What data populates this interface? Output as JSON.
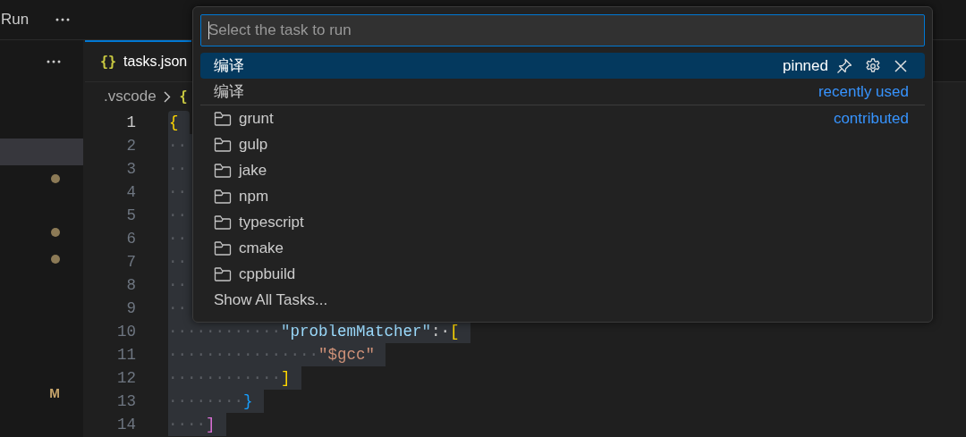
{
  "sidebar": {
    "title": "Run",
    "rows": [
      {
        "kind": "blank"
      },
      {
        "kind": "blank"
      },
      {
        "kind": "highlight"
      },
      {
        "kind": "dot"
      },
      {
        "kind": "blank"
      },
      {
        "kind": "dot"
      },
      {
        "kind": "dot"
      },
      {
        "kind": "blank"
      },
      {
        "kind": "blank"
      },
      {
        "kind": "blank"
      },
      {
        "kind": "blank"
      },
      {
        "kind": "status",
        "status": "M"
      }
    ]
  },
  "editor": {
    "tab": {
      "icon": "{}",
      "label": "tasks.json",
      "selected": true
    },
    "breadcrumb": [
      {
        "label": ".vscode"
      },
      {
        "icon": "{"
      }
    ],
    "lines": [
      {
        "number": "1",
        "active": true,
        "tokens": [
          {
            "text": "{",
            "color": "#ffd700"
          }
        ]
      },
      {
        "number": "2",
        "active": false,
        "whitespace": "··"
      },
      {
        "number": "3",
        "active": false,
        "whitespace": "··"
      },
      {
        "number": "4",
        "active": false,
        "whitespace": "··"
      },
      {
        "number": "5",
        "active": false,
        "whitespace": "··"
      },
      {
        "number": "6",
        "active": false,
        "whitespace": "··"
      },
      {
        "number": "7",
        "active": false,
        "whitespace": "··"
      },
      {
        "number": "8",
        "active": false,
        "whitespace": "··"
      },
      {
        "number": "9",
        "active": false,
        "whitespace": "··"
      },
      {
        "number": "10",
        "active": false,
        "whitespace": "············",
        "tokens": [
          {
            "text": "\"problemMatcher\"",
            "color": "#9cdcfe"
          },
          {
            "text": ":·",
            "color": "#cccccc"
          },
          {
            "text": "[",
            "color": "#ffd700"
          }
        ]
      },
      {
        "number": "11",
        "active": false,
        "whitespace": "················",
        "tokens": [
          {
            "text": "\"$gcc\"",
            "color": "#ce9178"
          }
        ]
      },
      {
        "number": "12",
        "active": false,
        "whitespace": "············",
        "tokens": [
          {
            "text": "]",
            "color": "#ffd700"
          }
        ]
      },
      {
        "number": "13",
        "active": false,
        "whitespace": "········",
        "tokens": [
          {
            "text": "}",
            "color": "#179fff"
          }
        ]
      },
      {
        "number": "14",
        "active": false,
        "whitespace": "····",
        "tokens": [
          {
            "text": "]",
            "color": "#da70d6"
          }
        ]
      }
    ]
  },
  "quick_pick": {
    "placeholder": "Select the task to run",
    "items": [
      {
        "label": "编译",
        "kind": "task",
        "selected": true,
        "detail": "pinned",
        "separator": false
      },
      {
        "label": "编译",
        "kind": "task",
        "selected": false,
        "detail": "recently used",
        "separator": true
      },
      {
        "label": "grunt",
        "kind": "folder",
        "selected": false,
        "detail": "contributed",
        "separator": false
      },
      {
        "label": "gulp",
        "kind": "folder",
        "selected": false,
        "separator": false
      },
      {
        "label": "jake",
        "kind": "folder",
        "selected": false,
        "separator": false
      },
      {
        "label": "npm",
        "kind": "folder",
        "selected": false,
        "separator": false
      },
      {
        "label": "typescript",
        "kind": "folder",
        "selected": false,
        "separator": false
      },
      {
        "label": "cmake",
        "kind": "folder",
        "selected": false,
        "separator": false
      },
      {
        "label": "cppbuild",
        "kind": "folder",
        "selected": false,
        "separator": false
      },
      {
        "label": "Show All Tasks...",
        "kind": "command",
        "selected": false,
        "separator": false
      }
    ]
  }
}
